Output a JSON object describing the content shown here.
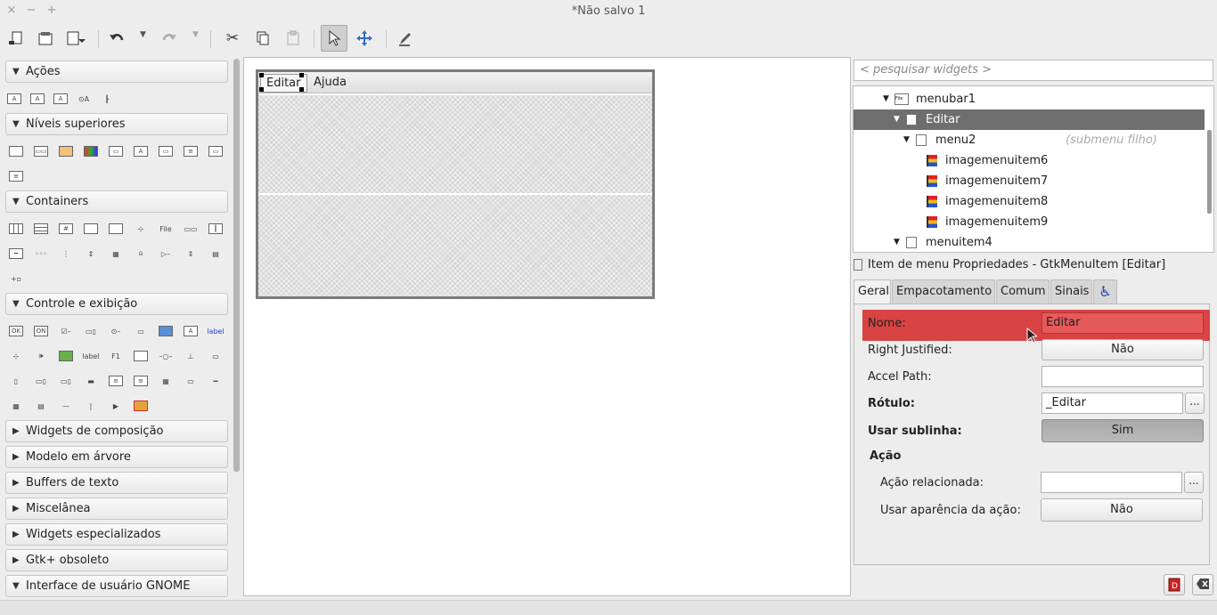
{
  "window": {
    "title": "*Não salvo 1",
    "close": "×",
    "minimize": "−",
    "maximize": "+"
  },
  "toolbar": {
    "icons": [
      "new-icon",
      "open-icon",
      "save-icon",
      "undo-icon",
      "redo-icon",
      "cut-icon",
      "copy-icon",
      "paste-icon",
      "selector-icon",
      "drag-resize-icon",
      "edit-icon"
    ]
  },
  "palette": {
    "sections": [
      {
        "label": "Ações",
        "expanded": true
      },
      {
        "label": "Níveis superiores",
        "expanded": true
      },
      {
        "label": "Containers",
        "expanded": true
      },
      {
        "label": "Controle e exibição",
        "expanded": true
      },
      {
        "label": "Widgets de composição",
        "expanded": false
      },
      {
        "label": "Modelo em árvore",
        "expanded": false
      },
      {
        "label": "Buffers de texto",
        "expanded": false
      },
      {
        "label": "Miscelânea",
        "expanded": false
      },
      {
        "label": "Widgets especializados",
        "expanded": false
      },
      {
        "label": "Gtk+ obsoleto",
        "expanded": false
      },
      {
        "label": "Interface de usuário GNOME",
        "expanded": true
      }
    ],
    "icon_texts": {
      "file": "File",
      "ok": "OK",
      "on": "ON",
      "label": "label",
      "label_blue": "label",
      "f1": "F1",
      "a": "A"
    }
  },
  "design": {
    "menu_items": [
      "Editar",
      "Ajuda"
    ]
  },
  "search": {
    "placeholder": "< pesquisar widgets >"
  },
  "tree": {
    "rows": [
      {
        "label": "menubar1",
        "hint": ""
      },
      {
        "label": "Editar",
        "hint": ""
      },
      {
        "label": "menu2",
        "hint": "(submenu filho)"
      },
      {
        "label": "imagemenuitem6",
        "hint": ""
      },
      {
        "label": "imagemenuitem7",
        "hint": ""
      },
      {
        "label": "imagemenuitem8",
        "hint": ""
      },
      {
        "label": "imagemenuitem9",
        "hint": ""
      },
      {
        "label": "menuitem4",
        "hint": ""
      }
    ],
    "selected": "Editar"
  },
  "properties": {
    "header": "Item de menu Propriedades - GtkMenuItem [Editar]",
    "tabs": [
      "Geral",
      "Empacotamento",
      "Comum",
      "Sinais"
    ],
    "active_tab": "Geral",
    "fields": {
      "name_label": "Nome:",
      "name_value": "Editar",
      "right_justified_label": "Right Justified:",
      "right_justified_value": "Não",
      "accel_path_label": "Accel Path:",
      "accel_path_value": "",
      "label_label": "Rótulo:",
      "label_value": "_Editar",
      "use_underline_label": "Usar sublinha:",
      "use_underline_value": "Sim",
      "action_section": "Ação",
      "related_action_label": "Ação relacionada:",
      "related_action_value": "",
      "use_action_appearance_label": "Usar aparência da ação:",
      "use_action_appearance_value": "Não",
      "ellipsis": "..."
    }
  },
  "colors": {
    "highlight": "#d84343",
    "selection": "#6e6e6e"
  }
}
